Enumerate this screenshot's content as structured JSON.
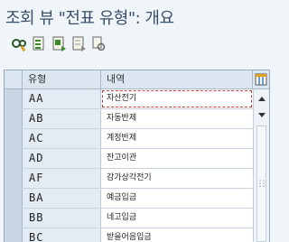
{
  "window": {
    "title": "조회 뷰 \"전표 유형\": 개요"
  },
  "toolbar": {
    "buttons": [
      {
        "name": "display-change-toggle",
        "icon": "glasses-pencil-icon"
      },
      {
        "name": "select-all",
        "icon": "select-all-icon"
      },
      {
        "name": "select-block",
        "icon": "select-block-icon"
      },
      {
        "name": "deselect-all",
        "icon": "deselect-all-icon"
      },
      {
        "name": "print",
        "icon": "print-icon"
      }
    ]
  },
  "grid": {
    "columns": [
      "유형",
      "내역"
    ],
    "rows": [
      {
        "key": "AA",
        "text": "자산전기"
      },
      {
        "key": "AB",
        "text": "자동반제"
      },
      {
        "key": "AC",
        "text": "계정반제"
      },
      {
        "key": "AD",
        "text": "잔고이관"
      },
      {
        "key": "AF",
        "text": "감가상각전기"
      },
      {
        "key": "BA",
        "text": "예금입금"
      },
      {
        "key": "BB",
        "text": "네고입금"
      },
      {
        "key": "BC",
        "text": "받을어음입금"
      }
    ],
    "config_icon": "column-config-icon"
  },
  "colors": {
    "accent": "#3a5068",
    "header_bg": "#dbe6f0",
    "key_bg": "#e3ebf3"
  }
}
